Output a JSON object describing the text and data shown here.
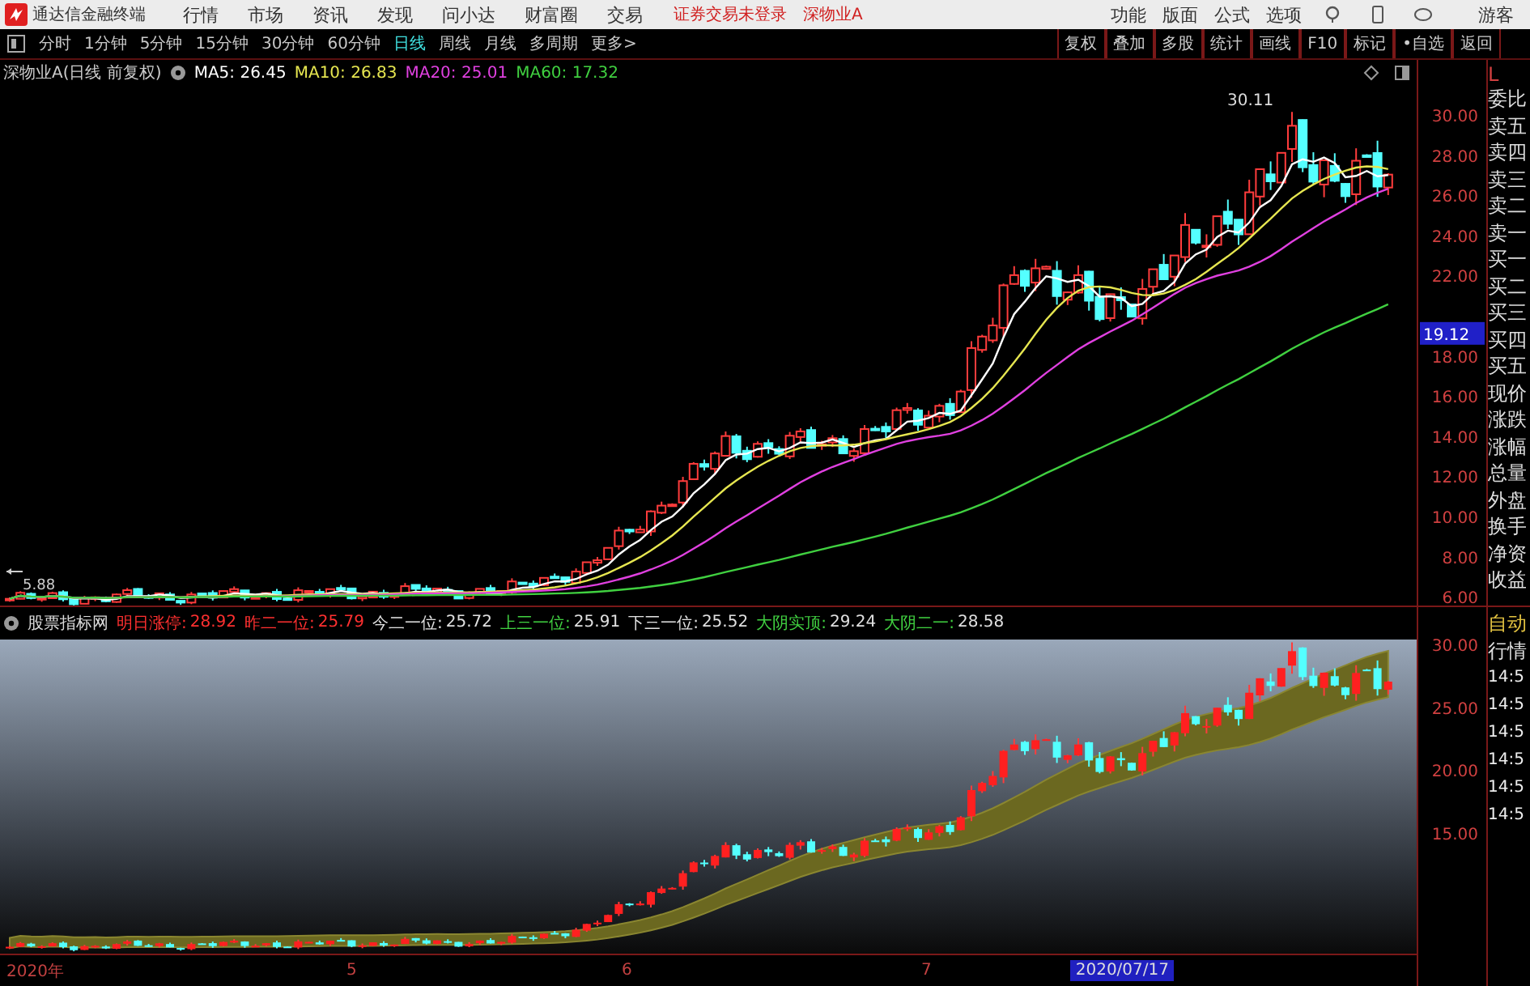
{
  "menubar": {
    "app_title": "通达信金融终端",
    "menu": [
      "行情",
      "市场",
      "资讯",
      "发现",
      "问小达",
      "财富圈",
      "交易"
    ],
    "status": [
      {
        "text": "证券交易未登录"
      },
      {
        "text": "深物业A"
      }
    ],
    "right_menu": [
      "功能",
      "版面",
      "公式",
      "选项"
    ],
    "user": "游客"
  },
  "period_tabs": [
    {
      "label": "分时",
      "selected": false
    },
    {
      "label": "1分钟",
      "selected": false
    },
    {
      "label": "5分钟",
      "selected": false
    },
    {
      "label": "15分钟",
      "selected": false
    },
    {
      "label": "30分钟",
      "selected": false
    },
    {
      "label": "60分钟",
      "selected": false
    },
    {
      "label": "日线",
      "selected": true
    },
    {
      "label": "周线",
      "selected": false
    },
    {
      "label": "月线",
      "selected": false
    },
    {
      "label": "多周期",
      "selected": false
    },
    {
      "label": "更多>",
      "selected": false
    }
  ],
  "tool_buttons": [
    "复权",
    "叠加",
    "多股",
    "统计",
    "画线",
    "F10",
    "标记",
    "•自选",
    "返回"
  ],
  "main_chart": {
    "title": "深物业A(日线 前复权)",
    "averages": [
      {
        "label": "MA5: 26.45",
        "color": "#ffffff"
      },
      {
        "label": "MA10: 26.83",
        "color": "#e6e650"
      },
      {
        "label": "MA20: 25.01",
        "color": "#e040e0"
      },
      {
        "label": "MA60: 17.32",
        "color": "#40d040"
      }
    ],
    "peak_label": "30.11",
    "low_label": "5.88",
    "y_ticks_upper": [
      "30.00",
      "28.00",
      "26.00",
      "24.00",
      "22.00"
    ],
    "y_ticks_lower": [
      "18.00",
      "16.00",
      "14.00",
      "12.00",
      "10.00",
      "8.00",
      "6.00"
    ],
    "price_marker": "19.12"
  },
  "side_panel": {
    "corner": "L",
    "quote_labels": [
      "委比",
      "卖五",
      "卖四",
      "卖三",
      "卖二",
      "卖一",
      "买一",
      "买二",
      "买三",
      "买四",
      "买五",
      "现价",
      "涨跌",
      "涨幅",
      "总量",
      "外盘",
      "换手",
      "净资",
      "收益"
    ],
    "lower_labels": [
      "自动",
      "行情"
    ],
    "times": [
      "14:5",
      "14:5",
      "14:5",
      "14:5",
      "14:5",
      "14:5"
    ]
  },
  "indicator": {
    "name": "股票指标网",
    "values": [
      {
        "label": {
          "text": "明日涨停:",
          "color": "#ff3030"
        },
        "value": {
          "text": "28.92",
          "color": "#ff3030"
        }
      },
      {
        "label": {
          "text": "昨二一位:",
          "color": "#ff3030"
        },
        "value": {
          "text": "25.79",
          "color": "#ff3030"
        }
      },
      {
        "label": {
          "text": "今二一位:",
          "color": "#e0e0e0"
        },
        "value": {
          "text": "25.72",
          "color": "#e0e0e0"
        }
      },
      {
        "label": {
          "text": "上三一位:",
          "color": "#40d040"
        },
        "value": {
          "text": "25.91",
          "color": "#e0e0e0"
        }
      },
      {
        "label": {
          "text": "下三一位:",
          "color": "#e0e0e0"
        },
        "value": {
          "text": "25.52",
          "color": "#e0e0e0"
        }
      },
      {
        "label": {
          "text": "大阴实顶:",
          "color": "#40d040"
        },
        "value": {
          "text": "29.24",
          "color": "#e0e0e0"
        }
      },
      {
        "label": {
          "text": "大阴二一:",
          "color": "#40d040"
        },
        "value": {
          "text": "28.58",
          "color": "#e0e0e0"
        }
      }
    ],
    "y_ticks": [
      "30.00",
      "25.00",
      "20.00",
      "15.00"
    ]
  },
  "date_axis": {
    "labels": [
      "2020年",
      "5",
      "6",
      "7"
    ],
    "cursor_date": "2020/07/17"
  }
}
